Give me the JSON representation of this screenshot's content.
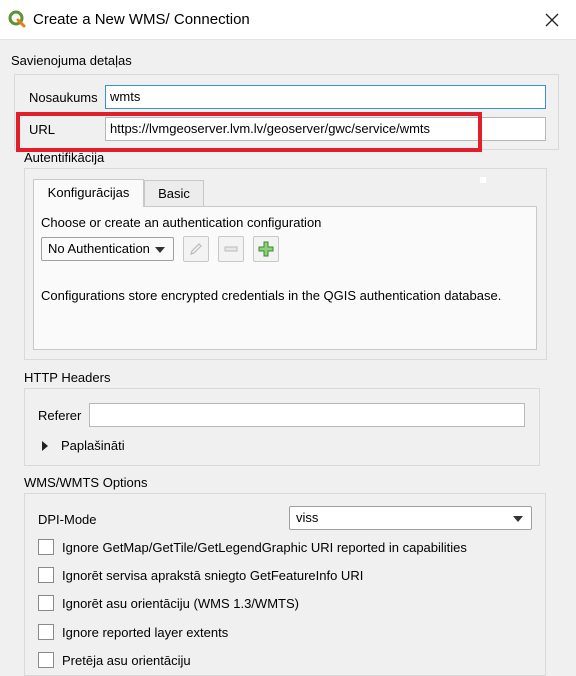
{
  "window": {
    "title": "Create a New WMS/ Connection"
  },
  "connection": {
    "section_label": "Savienojuma detaļas",
    "name_label": "Nosaukums",
    "name_value": "wmts",
    "url_label": "URL",
    "url_value": "https://lvmgeoserver.lvm.lv/geoserver/gwc/service/wmts"
  },
  "auth": {
    "section_label": "Autentifikācija",
    "tabs": [
      {
        "label": "Konfigurācijas",
        "active": true
      },
      {
        "label": "Basic",
        "active": false
      }
    ],
    "prompt": "Choose or create an authentication configuration",
    "combo_value": "No Authentication",
    "info": "Configurations store encrypted credentials in the QGIS authentication database."
  },
  "http_headers": {
    "section_label": "HTTP Headers",
    "referer_label": "Referer",
    "referer_value": "",
    "advanced_label": "Paplašināti"
  },
  "options": {
    "section_label": "WMS/WMTS Options",
    "dpi_label": "DPI-Mode",
    "dpi_value": "viss",
    "checkboxes": [
      {
        "label": "Ignore GetMap/GetTile/GetLegendGraphic URI reported in capabilities",
        "checked": false
      },
      {
        "label": "Ignorēt servisa aprakstā sniegto GetFeatureInfo URI",
        "checked": false
      },
      {
        "label": "Ignorēt asu orientāciju (WMS 1.3/WMTS)",
        "checked": false
      },
      {
        "label": "Ignore reported layer extents",
        "checked": false
      },
      {
        "label": "Pretēja asu orientāciju",
        "checked": false
      }
    ]
  },
  "icons": [
    "qgis-logo-icon",
    "close-icon",
    "pencil-icon",
    "minus-icon",
    "plus-icon",
    "expand-arrow-icon",
    "dropdown-arrow-icon"
  ],
  "colors": {
    "highlight": "#e01f2b",
    "qgis_green": "#589632",
    "focus": "#3a8fd6"
  }
}
